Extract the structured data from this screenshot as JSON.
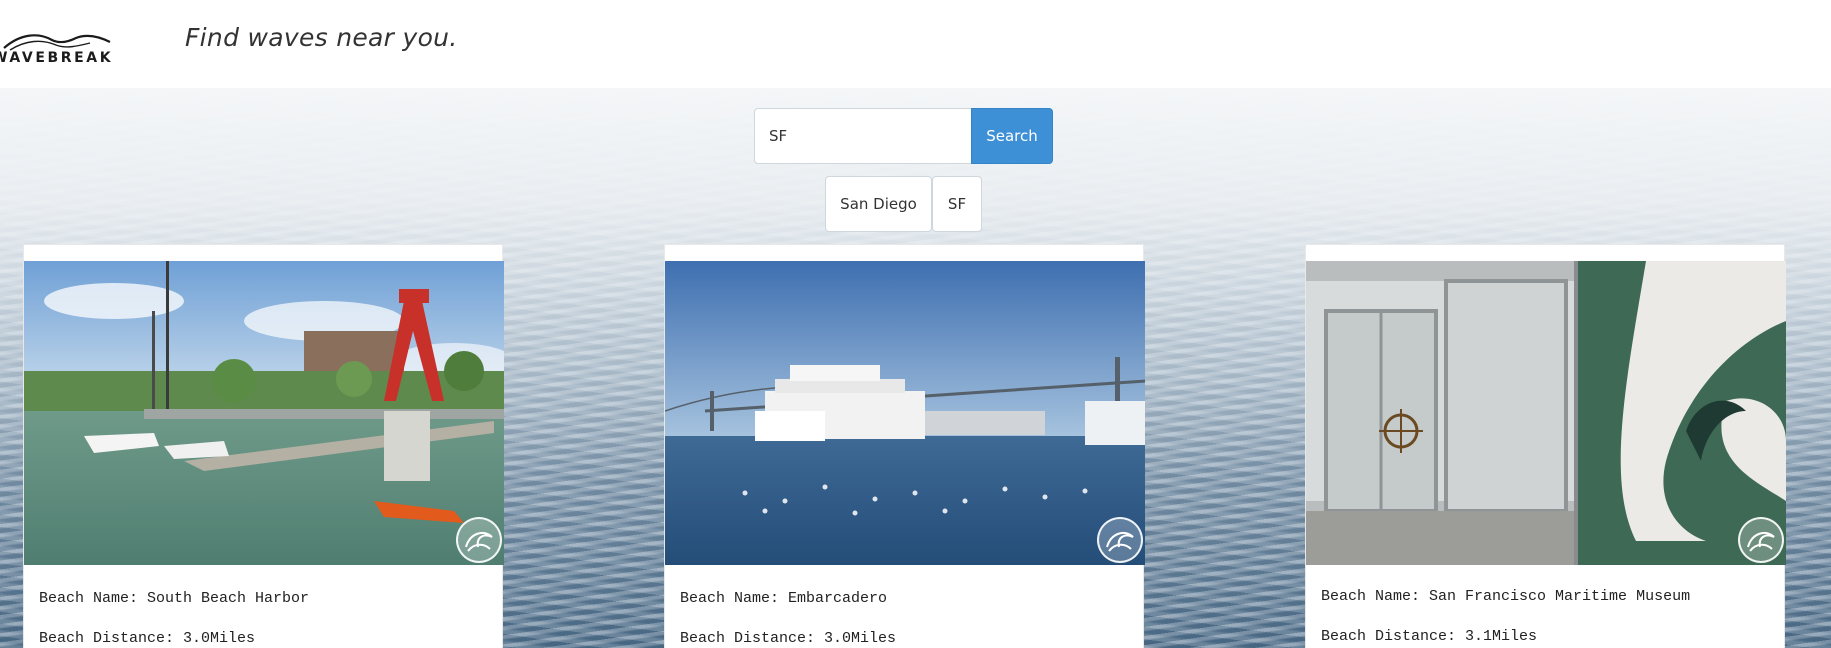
{
  "header": {
    "logo_text": "WAVEBREAK",
    "tagline": "Find waves near you."
  },
  "search": {
    "value": "SF",
    "button_label": "Search"
  },
  "recent_searches": [
    "San Diego",
    "SF"
  ],
  "beaches": [
    {
      "name_label": "Beach Name: ",
      "name": "South Beach Harbor",
      "distance_label": "Beach Distance: ",
      "distance": "3.0Miles"
    },
    {
      "name_label": "Beach Name: ",
      "name": "Embarcadero",
      "distance_label": "Beach Distance: ",
      "distance": "3.0Miles"
    },
    {
      "name_label": "Beach Name: ",
      "name": "San Francisco Maritime Museum",
      "distance_label": "Beach Distance: ",
      "distance": "3.1Miles"
    }
  ],
  "colors": {
    "accent": "#3d8fd6",
    "header_bg": "#ffffff"
  }
}
